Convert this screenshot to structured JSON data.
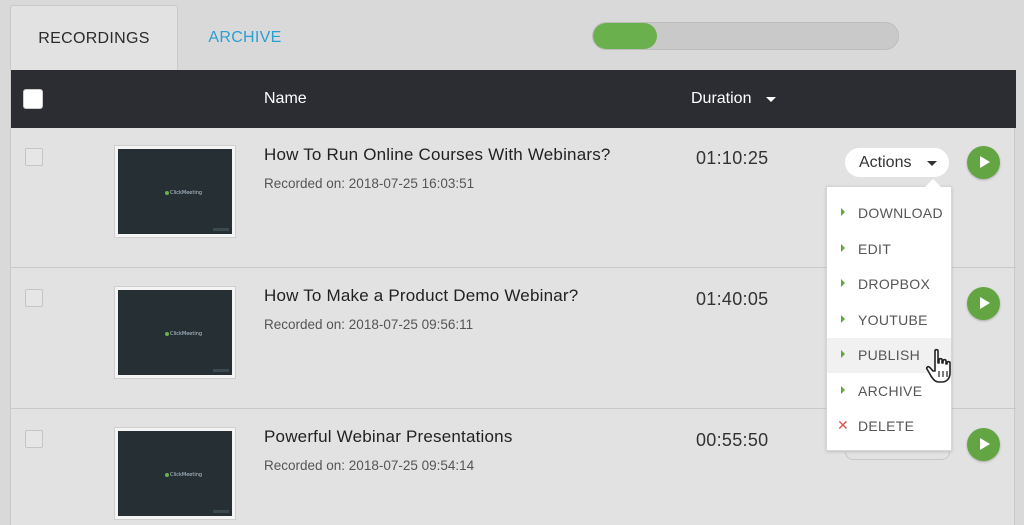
{
  "tabs": [
    {
      "label": "RECORDINGS",
      "active": true
    },
    {
      "label": "ARCHIVE",
      "active": false
    }
  ],
  "progress": {
    "fraction": 0.21,
    "color": "#6ab04c"
  },
  "table": {
    "headers": {
      "name": "Name",
      "duration": "Duration"
    },
    "rows": [
      {
        "title": "How To Run Online Courses With Webinars?",
        "recorded": "Recorded on: 2018-07-25 16:03:51",
        "duration": "01:10:25"
      },
      {
        "title": "How To Make a Product Demo Webinar?",
        "recorded": "Recorded on: 2018-07-25 09:56:11",
        "duration": "01:40:05"
      },
      {
        "title": "Powerful Webinar Presentations",
        "recorded": "Recorded on: 2018-07-25 09:54:14",
        "duration": "00:55:50"
      }
    ]
  },
  "actions": {
    "label": "Actions",
    "menu": [
      "DOWNLOAD",
      "EDIT",
      "DROPBOX",
      "YOUTUBE",
      "PUBLISH",
      "ARCHIVE",
      "DELETE"
    ],
    "hovered": "PUBLISH"
  },
  "icons": {
    "play": "play-icon",
    "delete": "close-icon",
    "cursor": "hand-pointer-icon"
  },
  "colors": {
    "accent_green": "#62a542",
    "link_blue": "#2a9fd6",
    "header_dark": "#2b2d33",
    "delete_red": "#d9534f"
  }
}
